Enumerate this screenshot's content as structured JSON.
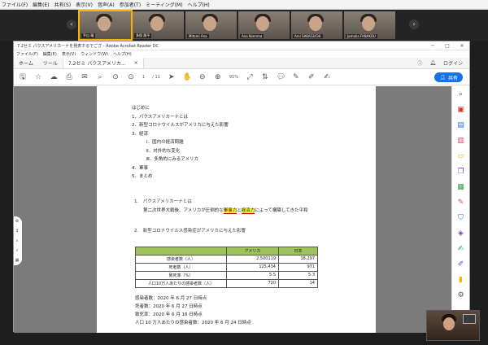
{
  "zoom": {
    "menu": [
      "ファイル(F)",
      "編集(E)",
      "共有(S)",
      "表示(V)",
      "音声(A)",
      "参加者(T)",
      "ミーティング(M)",
      "ヘルプ(H)"
    ],
    "participants": [
      "平山 瑠",
      "多保 翔平",
      "Mitomi Ana",
      "Ana Kennma",
      "Ami SAKAGUCHI",
      "Jamalia FANAKOU"
    ],
    "prev_icon": "‹",
    "next_icon": "›"
  },
  "acrobat": {
    "title": "7.2ゼミ パクスアメリカーナを発表するでござ - Adobe Acrobat Reader DC",
    "window_controls": [
      "─",
      "□",
      "✕"
    ],
    "menu": [
      "ファイル(F)",
      "編集(E)",
      "表示(V)",
      "ウィンドウ(W)",
      "ヘルプ(H)"
    ],
    "tabs": {
      "home": "ホーム",
      "tools": "ツール",
      "doc": "7.2ゼミ パクスアメリカ...",
      "doc_close": "×"
    },
    "login": "ログイン",
    "share": "共有",
    "page_current": "1",
    "page_total": "/ 11",
    "zoom_level": "91%"
  },
  "document": {
    "toc": [
      {
        "text": "はじめに",
        "sub": false
      },
      {
        "text": "1．パクスアメリカーナとは",
        "sub": false
      },
      {
        "text": "2．新型コロナウイルスがアメリカに与えた影響",
        "sub": false
      },
      {
        "text": "3．経済",
        "sub": false
      },
      {
        "text": "Ⅰ．国内の経済問題",
        "sub": true
      },
      {
        "text": "Ⅱ．対外的な変化",
        "sub": true
      },
      {
        "text": "Ⅲ．多角的にみるアメリカ",
        "sub": true
      },
      {
        "text": "4．軍事",
        "sub": false
      },
      {
        "text": "5．まとめ",
        "sub": false
      }
    ],
    "section1_heading": "1.　パクスアメリカーナとは",
    "section1_para": {
      "before": "第二次世界大戦後、アメリカが圧倒的な",
      "hl1": "軍事力",
      "mid": "と",
      "hl2": "経済力",
      "after": "によって構築してきた平和"
    },
    "section2_heading": "2.　新型コロナウイルス感染症がアメリカに与えた影響",
    "table": {
      "headers": [
        "",
        "アメリカ",
        "日本"
      ],
      "rows": [
        [
          "感染者数（人）",
          "2,500119",
          "18,297"
        ],
        [
          "死者数（人）",
          "125,434",
          "971"
        ],
        [
          "致死率（%）",
          "5.5",
          "5.3"
        ],
        [
          "人口10万人あたりの感染者数（人）",
          "720",
          "14"
        ]
      ]
    },
    "notes": [
      "感染者数：2020 年 6 月 27 日時点",
      "死者数：2020 年 6 月 27 日時点",
      "致死率：2020 年 6 月 16 日時点",
      "人口 10 万人あたりの感染者数：2020 年 6 月 24 日時点"
    ]
  }
}
